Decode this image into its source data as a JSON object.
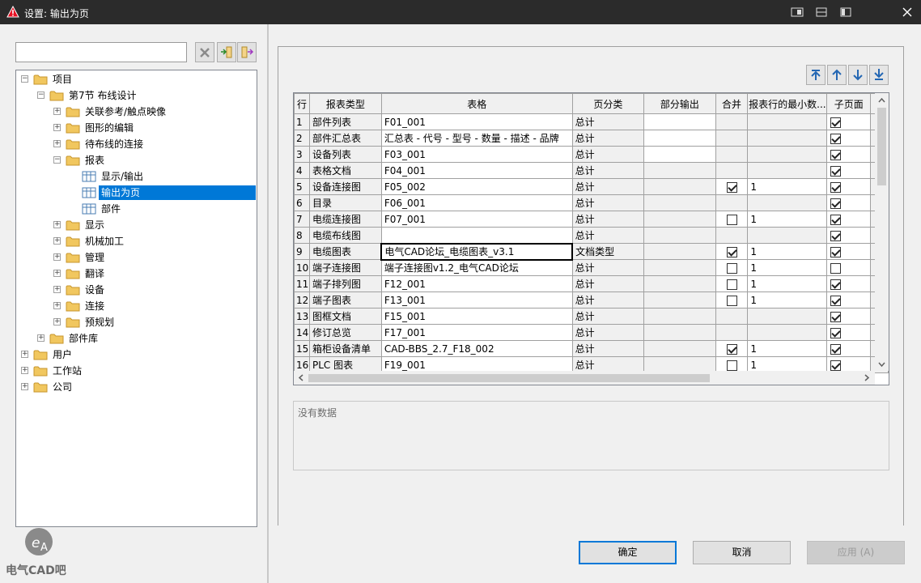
{
  "window": {
    "title": "设置: 输出为页"
  },
  "tree": [
    {
      "label": "项目",
      "level": 0,
      "expanded": true
    },
    {
      "label": "第7节 布线设计",
      "level": 1,
      "expanded": true
    },
    {
      "label": "关联参考/触点映像",
      "level": 2,
      "expanded": false
    },
    {
      "label": "图形的编辑",
      "level": 2,
      "expanded": false
    },
    {
      "label": "待布线的连接",
      "level": 2,
      "expanded": false
    },
    {
      "label": "报表",
      "level": 2,
      "expanded": true
    },
    {
      "label": "显示/输出",
      "level": 3,
      "leaf": true
    },
    {
      "label": "输出为页",
      "level": 3,
      "leaf": true,
      "selected": true
    },
    {
      "label": "部件",
      "level": 3,
      "leaf": true
    },
    {
      "label": "显示",
      "level": 2,
      "expanded": false
    },
    {
      "label": "机械加工",
      "level": 2,
      "expanded": false
    },
    {
      "label": "管理",
      "level": 2,
      "expanded": false
    },
    {
      "label": "翻译",
      "level": 2,
      "expanded": false
    },
    {
      "label": "设备",
      "level": 2,
      "expanded": false
    },
    {
      "label": "连接",
      "level": 2,
      "expanded": false
    },
    {
      "label": "预规划",
      "level": 2,
      "expanded": false
    },
    {
      "label": "部件库",
      "level": 1,
      "expanded": false
    },
    {
      "label": "用户",
      "level": 0,
      "expanded": false
    },
    {
      "label": "工作站",
      "level": 0,
      "expanded": false
    },
    {
      "label": "公司",
      "level": 0,
      "expanded": false
    }
  ],
  "table": {
    "columns": [
      "行",
      "报表类型",
      "表格",
      "页分类",
      "部分输出",
      "合并",
      "报表行的最小数...",
      "子页面"
    ],
    "rows": [
      {
        "n": "1",
        "type": "部件列表",
        "form": "F01_001",
        "page": "总计",
        "merge": null,
        "min": "",
        "sub": true
      },
      {
        "n": "2",
        "type": "部件汇总表",
        "form": "汇总表 - 代号 - 型号 - 数量 - 描述 - 品牌",
        "page": "总计",
        "merge": null,
        "min": "",
        "sub": true
      },
      {
        "n": "3",
        "type": "设备列表",
        "form": "F03_001",
        "page": "总计",
        "merge": null,
        "min": "",
        "sub": true
      },
      {
        "n": "4",
        "type": "表格文档",
        "form": "F04_001",
        "page": "总计",
        "merge": null,
        "min": "",
        "sub": true
      },
      {
        "n": "5",
        "type": "设备连接图",
        "form": "F05_002",
        "page": "总计",
        "merge": true,
        "min": "1",
        "sub": true
      },
      {
        "n": "6",
        "type": "目录",
        "form": "F06_001",
        "page": "总计",
        "merge": null,
        "min": "",
        "sub": true
      },
      {
        "n": "7",
        "type": "电缆连接图",
        "form": "F07_001",
        "page": "总计",
        "merge": false,
        "min": "1",
        "sub": true
      },
      {
        "n": "8",
        "type": "电缆布线图",
        "form": "",
        "page": "总计",
        "merge": null,
        "min": "",
        "sub": true
      },
      {
        "n": "9",
        "type": "电缆图表",
        "form": "电气CAD论坛_电缆图表_v3.1",
        "page": "文档类型",
        "merge": true,
        "min": "1",
        "sub": true
      },
      {
        "n": "10",
        "type": "端子连接图",
        "form": "端子连接图v1.2_电气CAD论坛",
        "page": "总计",
        "merge": false,
        "min": "1",
        "sub": false
      },
      {
        "n": "11",
        "type": "端子排列图",
        "form": "F12_001",
        "page": "总计",
        "merge": false,
        "min": "1",
        "sub": true
      },
      {
        "n": "12",
        "type": "端子图表",
        "form": "F13_001",
        "page": "总计",
        "merge": false,
        "min": "1",
        "sub": true
      },
      {
        "n": "13",
        "type": "图框文档",
        "form": "F15_001",
        "page": "总计",
        "merge": null,
        "min": "",
        "sub": true
      },
      {
        "n": "14",
        "type": "修订总览",
        "form": "F17_001",
        "page": "总计",
        "merge": null,
        "min": "",
        "sub": true
      },
      {
        "n": "15",
        "type": "箱柜设备清单",
        "form": "CAD-BBS_2.7_F18_002",
        "page": "总计",
        "merge": true,
        "min": "1",
        "sub": true
      },
      {
        "n": "16",
        "type": "PLC 图表",
        "form": "F19_001",
        "page": "总计",
        "merge": false,
        "min": "1",
        "sub": true
      }
    ]
  },
  "info": {
    "text": "没有数据"
  },
  "buttons": {
    "ok": "确定",
    "cancel": "取消",
    "apply": "应用 (A)"
  },
  "watermark": {
    "text": "电气CAD吧"
  },
  "icons": {
    "title": "warning-triangle-icon",
    "search_clear": "clear-x-icon",
    "nav": [
      "move-top-icon",
      "move-up-icon",
      "move-down-icon",
      "move-bottom-icon"
    ]
  }
}
